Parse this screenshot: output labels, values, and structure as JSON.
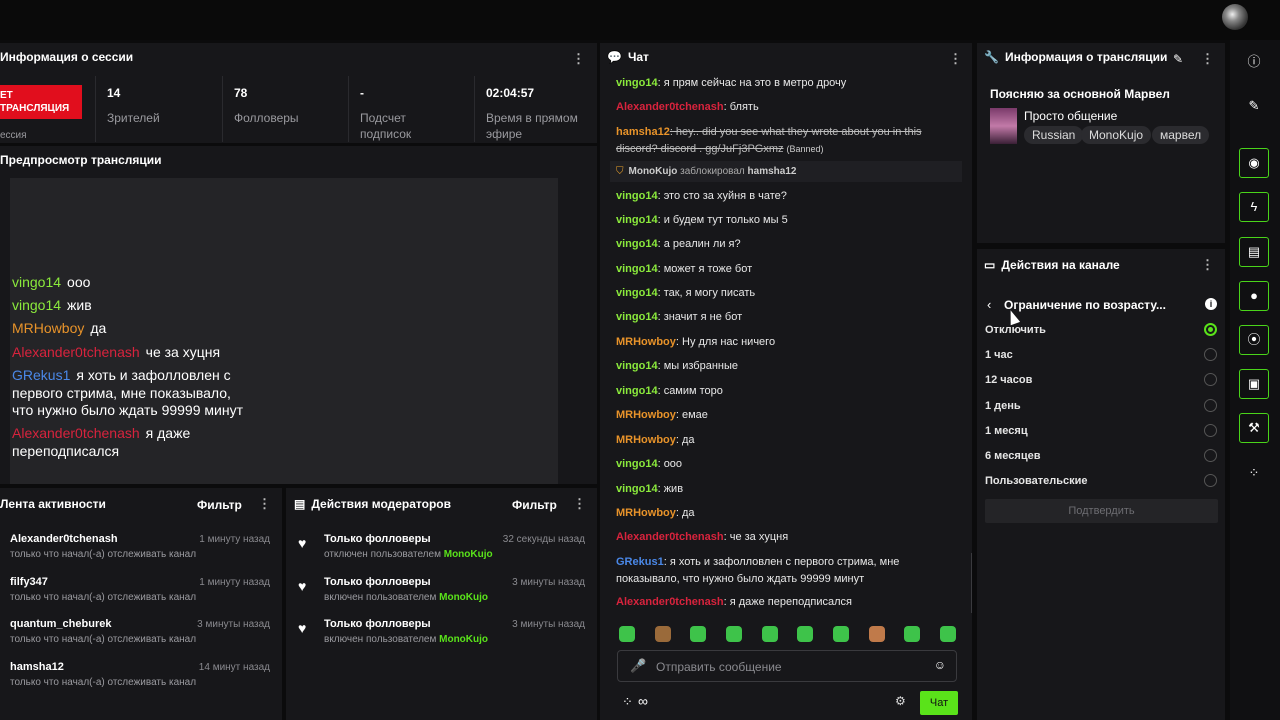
{
  "session": {
    "title": "Информация о сессии",
    "badge": "ЕТ\nТРАНСЛЯЦИЯ",
    "badge_sub": "ессия",
    "stats": [
      {
        "value": "14",
        "label": "Зрителей"
      },
      {
        "value": "78",
        "label": "Фолловеры"
      },
      {
        "value": "-",
        "label": "Подсчет подписок"
      },
      {
        "value": "02:04:57",
        "label": "Время в прямом эфире"
      }
    ]
  },
  "preview": {
    "title": "Предпросмотр трансляции",
    "overlay": [
      {
        "name": "vingo14",
        "text": "ооо",
        "color": "#8bea3c"
      },
      {
        "name": "vingo14",
        "text": "жив",
        "color": "#8bea3c"
      },
      {
        "name": "MRHowboy",
        "text": "да",
        "color": "#e8932a"
      },
      {
        "name": "Alexander0tchenash",
        "text": "че за хуцня",
        "color": "#d8233d"
      },
      {
        "name": "GRekus1",
        "text": "я хоть и зафолловлен с",
        "color": "#4a88e8"
      },
      {
        "name": "",
        "text": "первого стрима, мне показывало,",
        "color": "#fff"
      },
      {
        "name": "",
        "text": "что нужно было ждать 99999 минут",
        "color": "#fff"
      },
      {
        "name": "Alexander0tchenash",
        "text": "я даже",
        "color": "#d8233d"
      },
      {
        "name": "",
        "text": "переподписался",
        "color": "#fff"
      }
    ]
  },
  "chat": {
    "title": "Чат",
    "messages": [
      {
        "name": "vingo14",
        "text": ": я прям сейчас на это в метро дрочу",
        "cls": "green"
      },
      {
        "name": "Alexander0tchenash",
        "text": ": блять",
        "cls": "red"
      },
      {
        "name": "hamsha12",
        "text": ": hey.. did you see what they wrote about you in this discord? discord . gg/JuFj3PGxmz",
        "cls": "orange",
        "banned": "(Banned)"
      },
      {
        "name": "vingo14",
        "text": ": это сто за хуйня в чате?",
        "cls": "green"
      },
      {
        "name": "vingo14",
        "text": ": и будем тут только мы 5",
        "cls": "green"
      },
      {
        "name": "vingo14",
        "text": ": а реалин ли я?",
        "cls": "green"
      },
      {
        "name": "vingo14",
        "text": ": может я тоже бот",
        "cls": "green"
      },
      {
        "name": "vingo14",
        "text": ": так, я могу писать",
        "cls": "green"
      },
      {
        "name": "vingo14",
        "text": ": значит я не бот",
        "cls": "green"
      },
      {
        "name": "MRHowboy",
        "text": ": Ну для нас ничего",
        "cls": "orange"
      },
      {
        "name": "vingo14",
        "text": ": мы избранные",
        "cls": "green"
      },
      {
        "name": "vingo14",
        "text": ": самим торо",
        "cls": "green"
      },
      {
        "name": "MRHowboy",
        "text": ": емае",
        "cls": "orange"
      },
      {
        "name": "MRHowboy",
        "text": ": да",
        "cls": "orange"
      },
      {
        "name": "vingo14",
        "text": ": ооо",
        "cls": "green"
      },
      {
        "name": "vingo14",
        "text": ": жив",
        "cls": "green"
      },
      {
        "name": "MRHowboy",
        "text": ": да",
        "cls": "orange"
      },
      {
        "name": "Alexander0tchenash",
        "text": ": че за хуцня",
        "cls": "red"
      },
      {
        "name": "GRekus1",
        "text": ": я хоть и зафолловлен с первого стрима, мне показывало, что нужно было ждать 99999 минут",
        "cls": "blue"
      },
      {
        "name": "Alexander0tchenash",
        "text": ": я даже переподписался",
        "cls": "red"
      }
    ],
    "mod_notice": {
      "mod": "MonoKujo",
      "action": "заблокировал",
      "target": "hamsha12"
    },
    "input_placeholder": "Отправить сообщение",
    "send_label": "Чат",
    "points": "∞"
  },
  "stream_info": {
    "title": "Информация о трансляции",
    "stream_title": "Поясняю за основной Марвел",
    "category": "Просто общение",
    "tags": [
      "Russian",
      "MonoKujo",
      "марвел"
    ]
  },
  "channel_actions": {
    "title": "Действия на канале",
    "subtitle": "Ограничение по возрасту...",
    "options": [
      "Отключить",
      "1 час",
      "12 часов",
      "1 день",
      "1 месяц",
      "6 месяцев",
      "Пользовательские"
    ],
    "selected": 0,
    "confirm": "Подтвердить"
  },
  "activity": {
    "title": "Лента активности",
    "filter": "Фильтр",
    "items": [
      {
        "name": "Alexander0tchenash",
        "sub": "только что начал(-а) отслеживать канал",
        "time": "1 минуту назад"
      },
      {
        "name": "filfy347",
        "sub": "только что начал(-а) отслеживать канал",
        "time": "1 минуту назад"
      },
      {
        "name": "quantum_cheburek",
        "sub": "только что начал(-а) отслеживать канал",
        "time": "3 минуты назад"
      },
      {
        "name": "hamsha12",
        "sub": "только что начал(-а) отслеживать канал",
        "time": "14 минут назад"
      }
    ]
  },
  "mod_actions": {
    "title": "Действия модераторов",
    "filter": "Фильтр",
    "items": [
      {
        "name": "Только фолловеры",
        "sub": "отключен пользователем",
        "user": "MonoKujo",
        "time": "32 секунды назад"
      },
      {
        "name": "Только фолловеры",
        "sub": "включен пользователем",
        "user": "MonoKujo",
        "time": "3 минуты назад"
      },
      {
        "name": "Только фолловеры",
        "sub": "включен пользователем",
        "user": "MonoKujo",
        "time": "3 минуты назад"
      }
    ]
  },
  "sidebar": {
    "icons": [
      "info-icon",
      "pencil-icon",
      "camera-icon",
      "lightning-icon",
      "document-icon",
      "chat-bubble-icon",
      "broadcast-icon",
      "clip-icon",
      "wrench-icon",
      "connections-icon"
    ]
  }
}
